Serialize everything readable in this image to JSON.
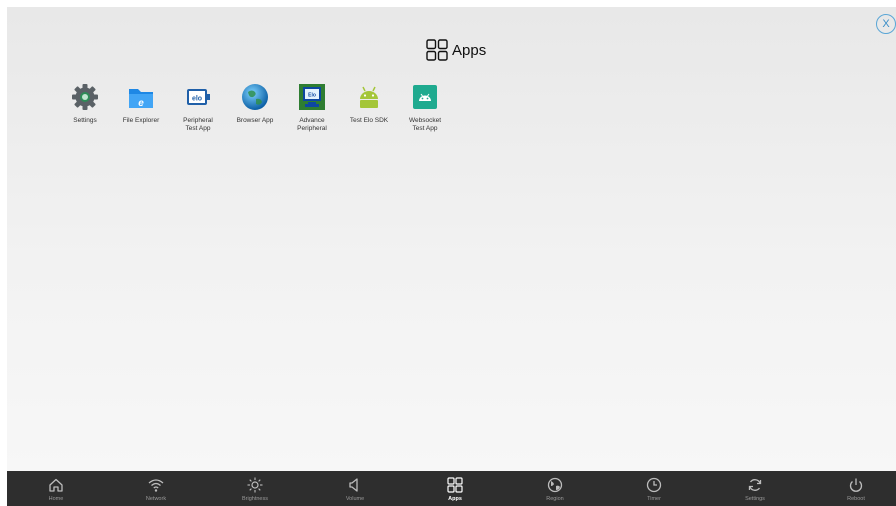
{
  "header": {
    "title": "Apps",
    "close_label": "X"
  },
  "apps": [
    {
      "label": "Settings",
      "icon": "gear-icon"
    },
    {
      "label": "File Explorer",
      "icon": "folder-icon"
    },
    {
      "label": "Peripheral\nTest App",
      "icon": "elo-peripheral-icon"
    },
    {
      "label": "Browser App",
      "icon": "globe-icon"
    },
    {
      "label": "Advance\nPeripheral",
      "icon": "elo-advance-icon"
    },
    {
      "label": "Test Elo SDK",
      "icon": "android-icon"
    },
    {
      "label": "Websocket\nTest App",
      "icon": "android-square-icon"
    }
  ],
  "taskbar": [
    {
      "label": "Home",
      "icon": "home-icon"
    },
    {
      "label": "Network",
      "icon": "wifi-icon"
    },
    {
      "label": "Brightness",
      "icon": "sun-icon"
    },
    {
      "label": "Volume",
      "icon": "volume-icon"
    },
    {
      "label": "Apps",
      "icon": "apps-grid-icon",
      "active": true
    },
    {
      "label": "Region",
      "icon": "globe-icon"
    },
    {
      "label": "Timer",
      "icon": "clock-icon"
    },
    {
      "label": "Settings",
      "icon": "sync-icon"
    },
    {
      "label": "Reboot",
      "icon": "power-icon"
    }
  ],
  "colors": {
    "taskbar_bg": "#2e2e2e",
    "close_accent": "#3a8ec8",
    "android_green": "#a4c639",
    "websocket_teal": "#1faa8f",
    "elo_blue": "#1f5fa8"
  }
}
